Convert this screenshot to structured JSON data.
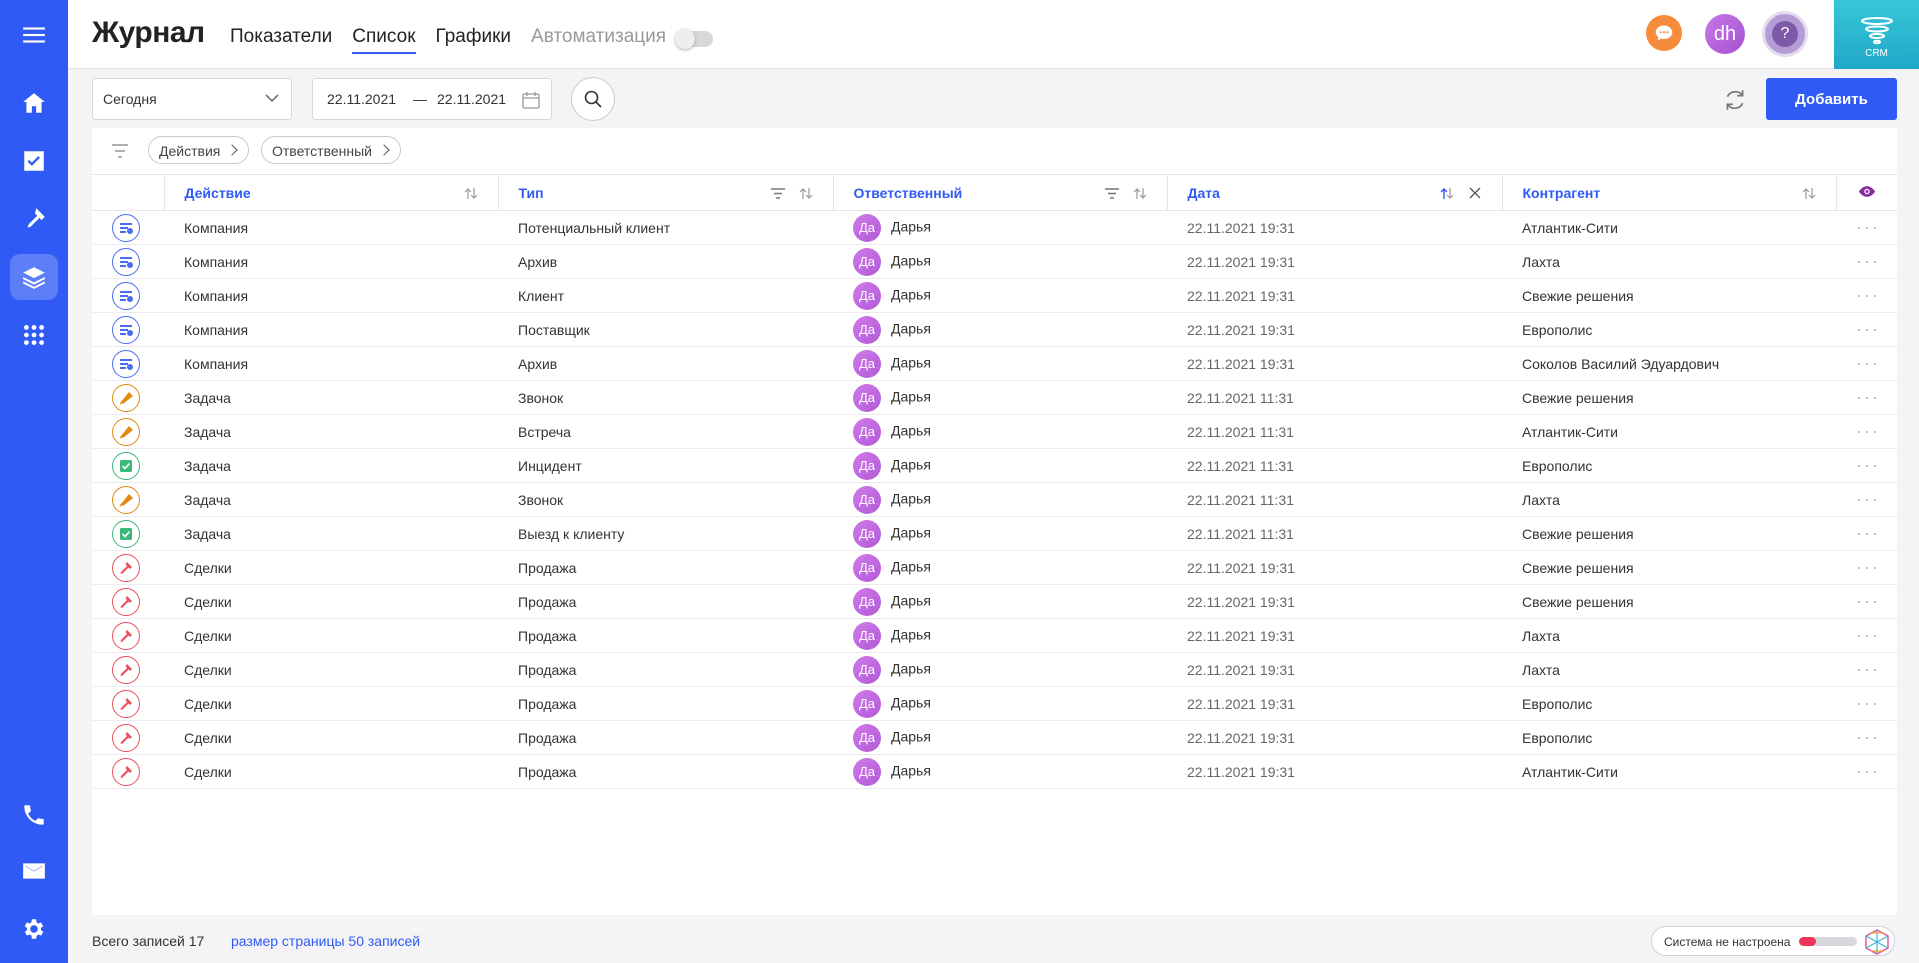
{
  "header": {
    "title": "Журнал",
    "tabs": [
      {
        "label": "Показатели",
        "state": "normal"
      },
      {
        "label": "Список",
        "state": "active"
      },
      {
        "label": "Графики",
        "state": "normal"
      },
      {
        "label": "Автоматизация",
        "state": "muted"
      }
    ],
    "user_initials": "dh",
    "help_label": "?",
    "crm_label": "CRM"
  },
  "filters": {
    "period": "Сегодня",
    "date_from": "22.11.2021",
    "date_sep": "—",
    "date_to": "22.11.2021",
    "add_label": "Добавить",
    "chips": [
      "Действия",
      "Ответственный"
    ]
  },
  "table": {
    "columns": [
      "Действие",
      "Тип",
      "Ответственный",
      "Дата",
      "Контрагент"
    ],
    "rows": [
      {
        "icon": "company",
        "action": "Компания",
        "type": "Потенциальный клиент",
        "resp": "Дарья",
        "date": "22.11.2021 19:31",
        "contractor": "Атлантик-Сити"
      },
      {
        "icon": "company",
        "action": "Компания",
        "type": "Архив",
        "resp": "Дарья",
        "date": "22.11.2021 19:31",
        "contractor": "Лахта"
      },
      {
        "icon": "company",
        "action": "Компания",
        "type": "Клиент",
        "resp": "Дарья",
        "date": "22.11.2021 19:31",
        "contractor": "Свежие решения"
      },
      {
        "icon": "company",
        "action": "Компания",
        "type": "Поставщик",
        "resp": "Дарья",
        "date": "22.11.2021 19:31",
        "contractor": "Европолис"
      },
      {
        "icon": "company",
        "action": "Компания",
        "type": "Архив",
        "resp": "Дарья",
        "date": "22.11.2021 19:31",
        "contractor": "Соколов Василий Эдуардович"
      },
      {
        "icon": "task-bell",
        "action": "Задача",
        "type": "Звонок",
        "resp": "Дарья",
        "date": "22.11.2021 11:31",
        "contractor": "Свежие решения"
      },
      {
        "icon": "task-bell",
        "action": "Задача",
        "type": "Встреча",
        "resp": "Дарья",
        "date": "22.11.2021 11:31",
        "contractor": "Атлантик-Сити"
      },
      {
        "icon": "task-check",
        "action": "Задача",
        "type": "Инцидент",
        "resp": "Дарья",
        "date": "22.11.2021 11:31",
        "contractor": "Европолис"
      },
      {
        "icon": "task-bell",
        "action": "Задача",
        "type": "Звонок",
        "resp": "Дарья",
        "date": "22.11.2021 11:31",
        "contractor": "Лахта"
      },
      {
        "icon": "task-check",
        "action": "Задача",
        "type": "Выезд к клиенту",
        "resp": "Дарья",
        "date": "22.11.2021 11:31",
        "contractor": "Свежие решения"
      },
      {
        "icon": "deal",
        "action": "Сделки",
        "type": "Продажа",
        "resp": "Дарья",
        "date": "22.11.2021 19:31",
        "contractor": "Свежие решения"
      },
      {
        "icon": "deal",
        "action": "Сделки",
        "type": "Продажа",
        "resp": "Дарья",
        "date": "22.11.2021 19:31",
        "contractor": "Свежие решения"
      },
      {
        "icon": "deal",
        "action": "Сделки",
        "type": "Продажа",
        "resp": "Дарья",
        "date": "22.11.2021 19:31",
        "contractor": "Лахта"
      },
      {
        "icon": "deal",
        "action": "Сделки",
        "type": "Продажа",
        "resp": "Дарья",
        "date": "22.11.2021 19:31",
        "contractor": "Лахта"
      },
      {
        "icon": "deal",
        "action": "Сделки",
        "type": "Продажа",
        "resp": "Дарья",
        "date": "22.11.2021 19:31",
        "contractor": "Европолис"
      },
      {
        "icon": "deal",
        "action": "Сделки",
        "type": "Продажа",
        "resp": "Дарья",
        "date": "22.11.2021 19:31",
        "contractor": "Европолис"
      },
      {
        "icon": "deal",
        "action": "Сделки",
        "type": "Продажа",
        "resp": "Дарья",
        "date": "22.11.2021 19:31",
        "contractor": "Атлантик-Сити"
      }
    ],
    "avatar_initials": "Да",
    "row_menu": "···"
  },
  "footer": {
    "total": "Всего записей 17",
    "page_size": "размер страницы 50 записей",
    "system_status": "Система не настроена",
    "setup_progress": 0.3
  },
  "colors": {
    "accent": "#2f5af5",
    "company_icon": "#4a6cf0",
    "task_bell_icon": "#e08a14",
    "task_check_icon": "#3cb878",
    "deal_icon": "#e8505b"
  }
}
